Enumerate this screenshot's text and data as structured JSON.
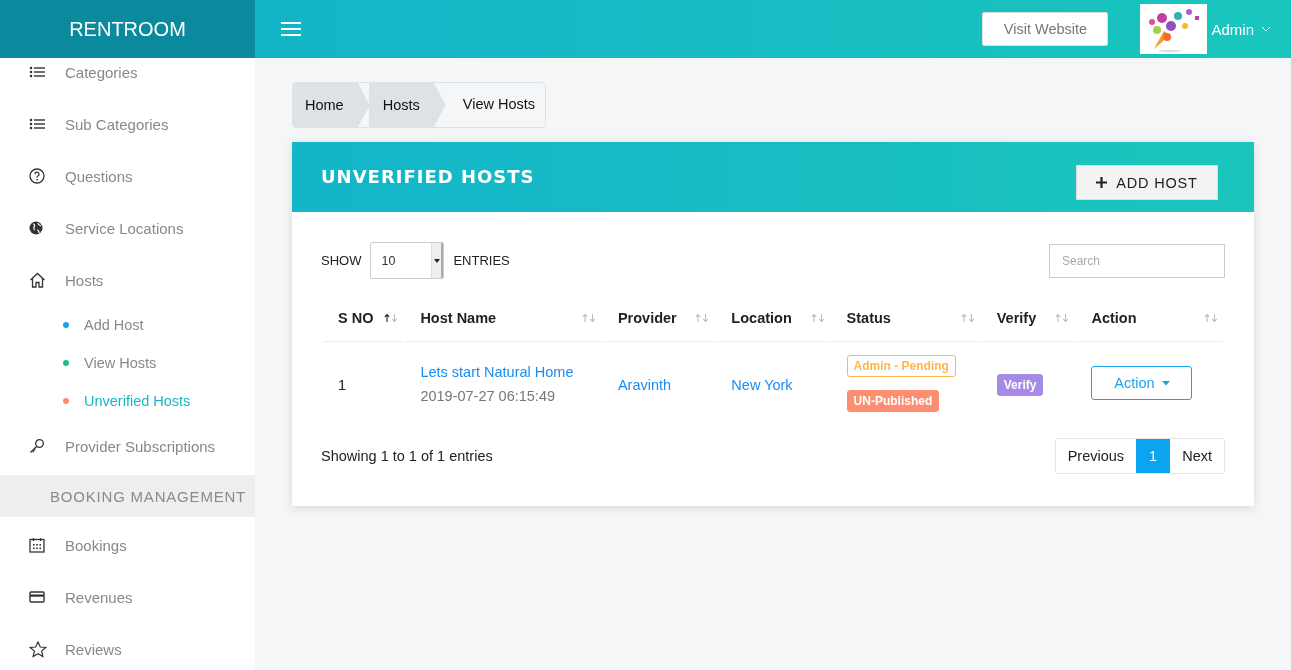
{
  "sidebar": {
    "brand": "RENTROOM",
    "items": [
      {
        "kind": "link",
        "label": "Categories",
        "selected": false
      },
      {
        "kind": "link",
        "label": "Sub Categories",
        "selected": false
      },
      {
        "kind": "link",
        "label": "Questions",
        "selected": false
      },
      {
        "kind": "link",
        "label": "Service Locations",
        "selected": false
      },
      {
        "kind": "link",
        "label": "Hosts",
        "selected": false,
        "children": [
          {
            "label": "Add Host",
            "color": "#1aa3f0",
            "selected": false
          },
          {
            "label": "View Hosts",
            "color": "#1bc088",
            "selected": false
          },
          {
            "label": "Unverified Hosts",
            "color": "#fb8a6e",
            "selected": true
          }
        ]
      },
      {
        "kind": "link",
        "label": "Provider Subscriptions",
        "selected": false
      },
      {
        "kind": "section",
        "label": "BOOKING MANAGEMENT"
      },
      {
        "kind": "link",
        "label": "Bookings",
        "selected": false
      },
      {
        "kind": "link",
        "label": "Revenues",
        "selected": false
      },
      {
        "kind": "link",
        "label": "Reviews",
        "selected": false
      }
    ]
  },
  "topbar": {
    "visit_button": "Visit Website",
    "user": "Admin"
  },
  "breadcrumb": [
    {
      "label": "Home",
      "current": false
    },
    {
      "label": "Hosts",
      "current": false
    },
    {
      "label": "View Hosts",
      "current": true
    }
  ],
  "card": {
    "title": "UNVERIFIED HOSTS",
    "add_button": "ADD HOST",
    "length": {
      "before": "SHOW",
      "value": "10",
      "after": "ENTRIES"
    },
    "search": {
      "placeholder": "Search"
    },
    "table": {
      "columns": [
        {
          "label": "S NO",
          "sorted": true
        },
        {
          "label": "Host Name",
          "sorted": false
        },
        {
          "label": "Provider",
          "sorted": false
        },
        {
          "label": "Location",
          "sorted": false
        },
        {
          "label": "Status",
          "sorted": false
        },
        {
          "label": "Verify",
          "sorted": false
        },
        {
          "label": "Action",
          "sorted": false
        }
      ],
      "rows": [
        {
          "sno": "1",
          "host_name": "Lets start Natural Home",
          "date": "2019-07-27 06:15:49",
          "provider": "Aravinth",
          "location": "New York",
          "status": [
            {
              "label": "Admin - Pending",
              "kind": "outline",
              "color": "#ffb64d"
            },
            {
              "label": "UN-Published",
              "kind": "filled",
              "color": "#fc8e72"
            }
          ],
          "verify": {
            "label": "Verify",
            "color": "#a58be6"
          },
          "action": "Action"
        }
      ]
    },
    "info": "Showing 1 to 1 of 1 entries",
    "pagination": {
      "previous": "Previous",
      "pages": [
        {
          "label": "1",
          "selected": true
        }
      ],
      "next": "Next"
    }
  }
}
